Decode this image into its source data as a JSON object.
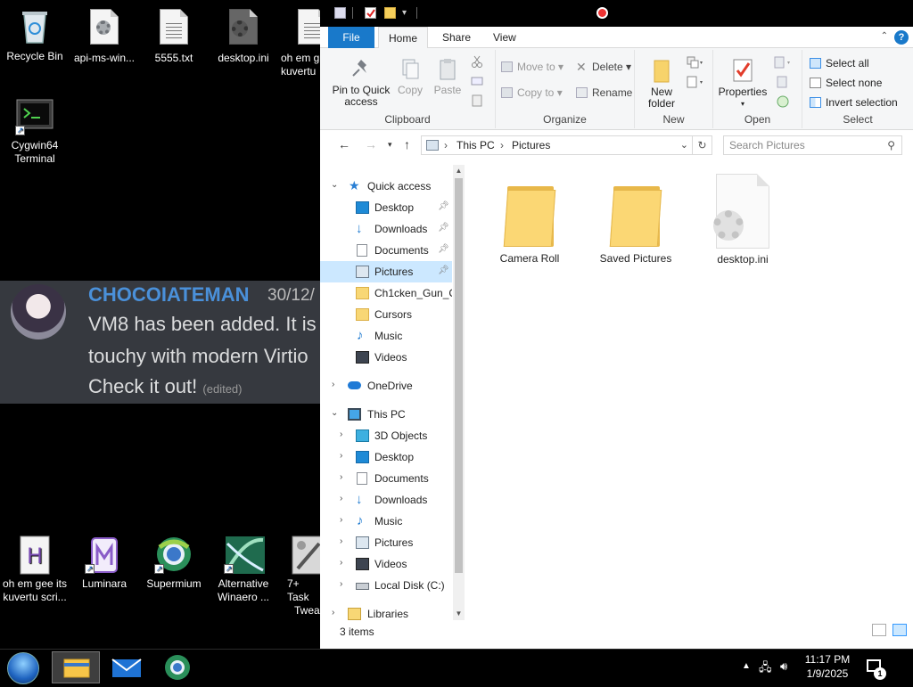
{
  "desktop": {
    "icons_top": [
      {
        "label": "Recycle Bin"
      },
      {
        "label": "api-ms-win..."
      },
      {
        "label": "5555.txt"
      },
      {
        "label": "desktop.ini"
      },
      {
        "label": "oh em g kuvertu"
      }
    ],
    "cygwin": {
      "line1": "Cygwin64",
      "line2": "Terminal"
    },
    "icons_bottom": [
      {
        "line1": "oh em gee its",
        "line2": "kuvertu scri..."
      },
      {
        "line1": "Luminara",
        "line2": ""
      },
      {
        "line1": "Supermium",
        "line2": ""
      },
      {
        "line1": "Alternative",
        "line2": "Winaero ..."
      },
      {
        "line1": "7+ Task",
        "line2": "Tweak"
      }
    ]
  },
  "chat": {
    "username": "CHOCOIATEMAN",
    "date": "30/12/",
    "line1": "VM8 has been added. It is",
    "line2": "touchy with modern Virtio",
    "line3": "Check it out!",
    "edited": "(edited)"
  },
  "explorer": {
    "tabs": {
      "file": "File",
      "home": "Home",
      "share": "Share",
      "view": "View"
    },
    "ribbon": {
      "pin_line1": "Pin to Quick",
      "pin_line2": "access",
      "copy": "Copy",
      "paste": "Paste",
      "clipboard": "Clipboard",
      "move_to": "Move to",
      "copy_to": "Copy to",
      "delete": "Delete",
      "rename": "Rename",
      "organize": "Organize",
      "new_folder_line1": "New",
      "new_folder_line2": "folder",
      "new": "New",
      "properties": "Properties",
      "open": "Open",
      "select_all": "Select all",
      "select_none": "Select none",
      "invert_selection": "Invert selection",
      "select": "Select"
    },
    "address": {
      "crumb1": "This PC",
      "crumb2": "Pictures"
    },
    "search_placeholder": "Search Pictures",
    "nav": {
      "quick_access": "Quick access",
      "qa_items": [
        "Desktop",
        "Downloads",
        "Documents",
        "Pictures",
        "Ch1cken_Gun_C",
        "Cursors",
        "Music",
        "Videos"
      ],
      "onedrive": "OneDrive",
      "this_pc": "This PC",
      "pc_items": [
        "3D Objects",
        "Desktop",
        "Documents",
        "Downloads",
        "Music",
        "Pictures",
        "Videos",
        "Local Disk (C:)"
      ],
      "libraries": "Libraries"
    },
    "files": [
      "Camera Roll",
      "Saved Pictures",
      "desktop.ini"
    ],
    "status": "3 items"
  },
  "taskbar": {
    "time": "11:17 PM",
    "date": "1/9/2025",
    "notification_count": "1"
  }
}
